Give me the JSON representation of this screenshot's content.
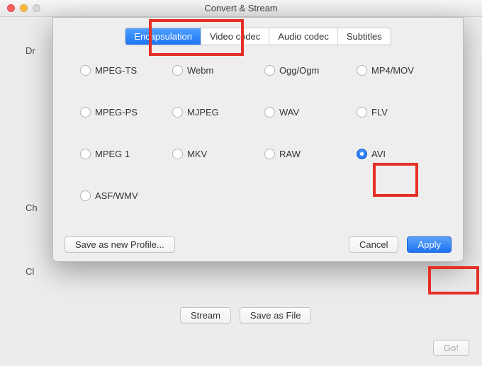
{
  "window": {
    "title": "Convert & Stream"
  },
  "background": {
    "label1": "Dr",
    "label2": "Ch",
    "label3": "Cl",
    "stream_btn": "Stream",
    "save_btn": "Save as File",
    "go_btn": "Go!"
  },
  "sheet": {
    "tabs": {
      "encapsulation": "Encapsulation",
      "video_codec": "Video codec",
      "audio_codec": "Audio codec",
      "subtitles": "Subtitles"
    },
    "options": {
      "mpeg_ts": "MPEG-TS",
      "webm": "Webm",
      "ogg": "Ogg/Ogm",
      "mp4": "MP4/MOV",
      "mpeg_ps": "MPEG-PS",
      "mjpeg": "MJPEG",
      "wav": "WAV",
      "flv": "FLV",
      "mpeg1": "MPEG 1",
      "mkv": "MKV",
      "raw": "RAW",
      "avi": "AVI",
      "asf": "ASF/WMV"
    },
    "selected": "avi",
    "save_profile": "Save as new Profile...",
    "cancel": "Cancel",
    "apply": "Apply"
  }
}
